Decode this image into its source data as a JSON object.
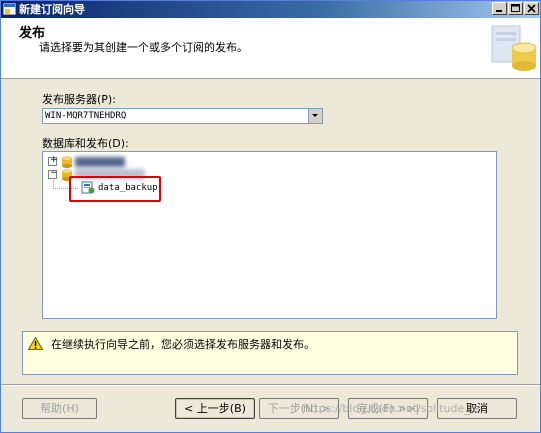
{
  "window": {
    "title": "新建订阅向导"
  },
  "header": {
    "title": "发布",
    "subtitle": "请选择要为其创建一个或多个订阅的发布。"
  },
  "publisher": {
    "label": "发布服务器(P):",
    "value": "WIN-MQR7TNEHDRQ"
  },
  "tree": {
    "label": "数据库和发布(D):",
    "items": [
      {
        "expander": "+",
        "icon": "database-icon",
        "label": ""
      },
      {
        "expander": "−",
        "icon": "database-icon",
        "label": ""
      }
    ],
    "publication": {
      "icon": "publication-icon",
      "label": "data_backup"
    }
  },
  "warning": {
    "icon": "warning-icon",
    "text": "在继续执行向导之前，您必须选择发布服务器和发布。"
  },
  "buttons": {
    "help": "帮助(H)",
    "back": "< 上一步(B)",
    "next": "下一步(N) >",
    "finish": "完成(F) >>|",
    "cancel": "取消"
  },
  "watermark": "https://blog.csdn.net/solitude_la",
  "colors": {
    "highlight": "#e00000",
    "accent": "#0a246a"
  }
}
